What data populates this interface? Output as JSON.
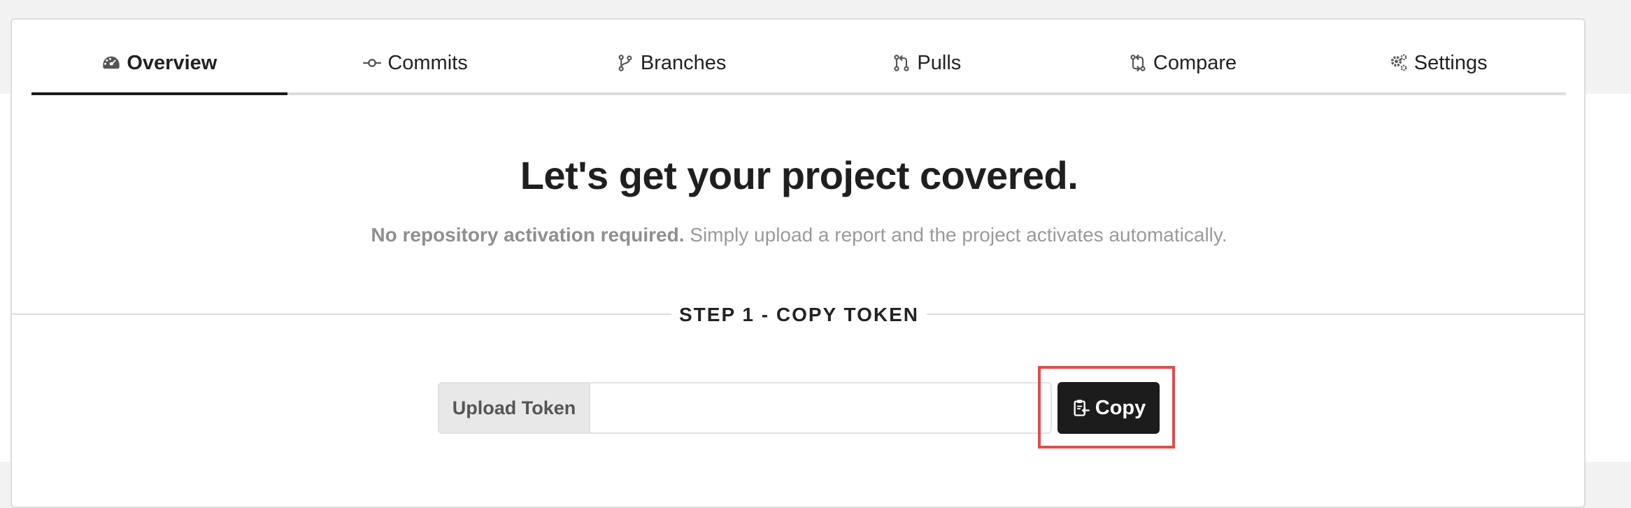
{
  "tabs": [
    {
      "label": "Overview",
      "icon": "dashboard-icon",
      "active": true
    },
    {
      "label": "Commits",
      "icon": "commit-icon",
      "active": false
    },
    {
      "label": "Branches",
      "icon": "branch-icon",
      "active": false
    },
    {
      "label": "Pulls",
      "icon": "pull-request-icon",
      "active": false
    },
    {
      "label": "Compare",
      "icon": "compare-icon",
      "active": false
    },
    {
      "label": "Settings",
      "icon": "gears-icon",
      "active": false
    }
  ],
  "main": {
    "headline": "Let's get your project covered.",
    "subline_bold": "No repository activation required.",
    "subline_rest": " Simply upload a report and the project activates automatically."
  },
  "step1": {
    "label": "STEP 1 - COPY TOKEN",
    "token_label": "Upload Token",
    "token_value": "",
    "copy_label": "Copy",
    "copy_icon": "clipboard-icon"
  },
  "colors": {
    "highlight": "#e24b4b",
    "button_bg": "#1c1c1c",
    "active_tab_underline": "#1b1b1b"
  }
}
